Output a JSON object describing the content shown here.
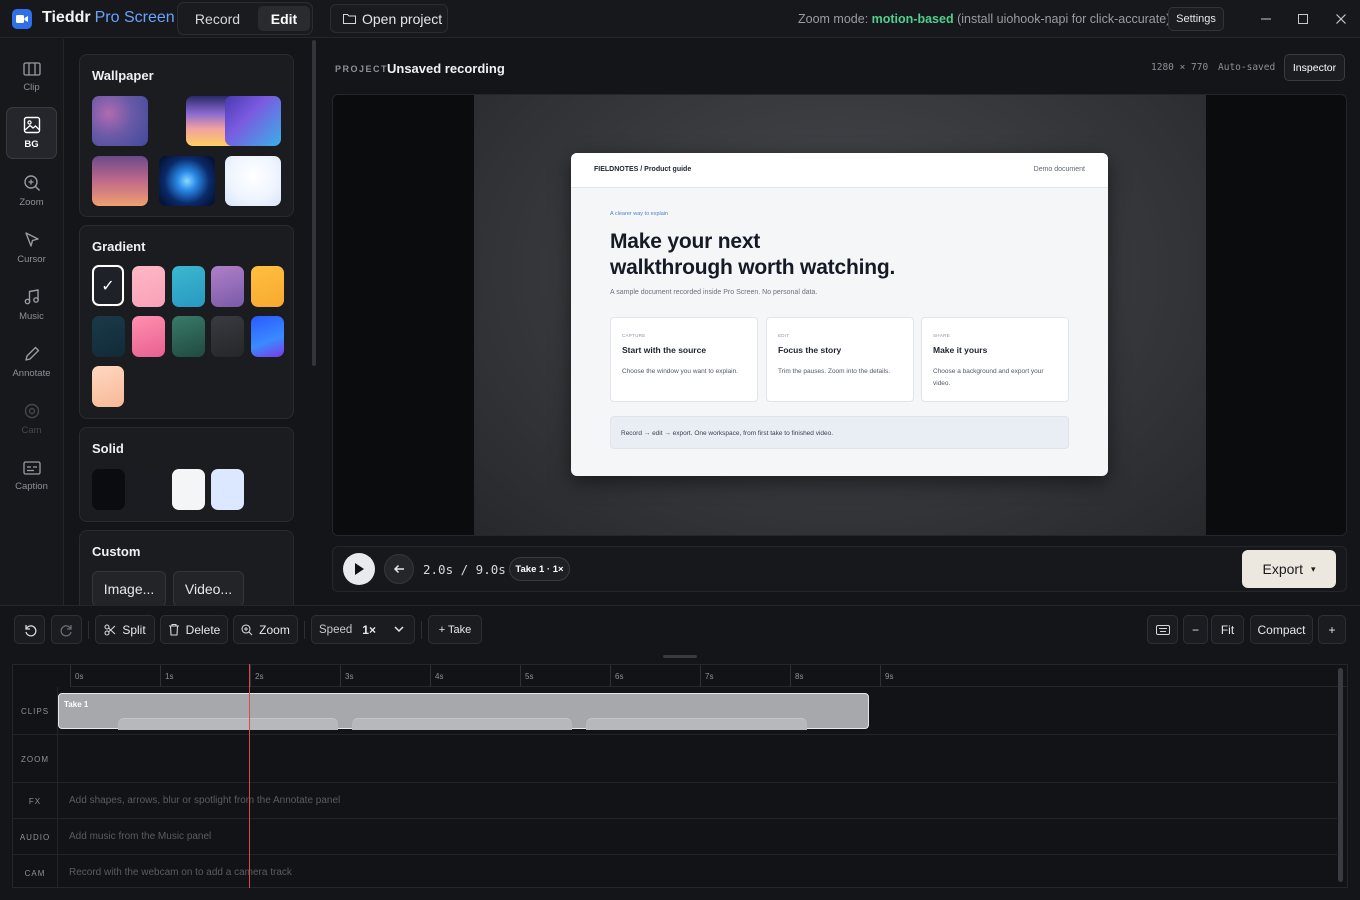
{
  "titlebar": {
    "app_name": "Tieddr",
    "app_name_accent": "Pro Screen",
    "modes": {
      "record": "Record",
      "edit": "Edit"
    },
    "open_project": "Open project",
    "zoom_mode_prefix": "Zoom mode: ",
    "zoom_mode_value": "motion-based",
    "zoom_mode_hint": " (install uiohook-napi for click-accurate)",
    "settings": "Settings"
  },
  "rail": {
    "items": [
      {
        "label": "Clip",
        "icon": "columns-icon"
      },
      {
        "label": "BG",
        "icon": "image-icon",
        "active": true
      },
      {
        "label": "Zoom",
        "icon": "zoom-in-icon"
      },
      {
        "label": "Cursor",
        "icon": "cursor-icon"
      },
      {
        "label": "Music",
        "icon": "music-icon"
      },
      {
        "label": "Annotate",
        "icon": "pencil-icon"
      },
      {
        "label": "Cam",
        "icon": "camera-icon",
        "disabled": true
      },
      {
        "label": "Caption",
        "icon": "caption-icon"
      }
    ]
  },
  "panel": {
    "wallpaper_title": "Wallpaper",
    "gradient_title": "Gradient",
    "solid_title": "Solid",
    "custom_title": "Custom",
    "custom_image": "Image...",
    "custom_video": "Video...",
    "selected_check": "✓"
  },
  "project": {
    "label": "PROJECT",
    "name": "Unsaved recording",
    "dimensions": "1280 × 770",
    "status": "Auto-saved",
    "inspector": "Inspector"
  },
  "document": {
    "brand": "FIELDNOTES / Product guide",
    "demo": "Demo document",
    "kicker": "A clearer way to explain",
    "headline_1": "Make your next",
    "headline_2": "walkthrough worth watching.",
    "subtitle": "A sample document recorded inside Pro Screen. No personal data.",
    "cards": [
      {
        "kicker": "CAPTURE",
        "title": "Start with the source",
        "text": "Choose the window you want to explain."
      },
      {
        "kicker": "EDIT",
        "title": "Focus the story",
        "text": "Trim the pauses. Zoom into the details."
      },
      {
        "kicker": "SHARE",
        "title": "Make it yours",
        "text": "Choose a background and export your video."
      }
    ],
    "footer": "Record → edit → export. One workspace, from first take to finished video."
  },
  "transport": {
    "timecode": "2.0s / 9.0s",
    "take": "Take 1 · 1×",
    "export": "Export",
    "export_caret": "▾"
  },
  "toolbar": {
    "split": "Split",
    "delete": "Delete",
    "zoom": "Zoom",
    "speed_label": "Speed",
    "speed_value": "1×",
    "add_take": "+ Take",
    "zoom_out": "−",
    "fit": "Fit",
    "compact": "Compact",
    "zoom_in": "+"
  },
  "timeline": {
    "ticks": [
      "0s",
      "1s",
      "2s",
      "3s",
      "4s",
      "5s",
      "6s",
      "7s",
      "8s",
      "9s"
    ],
    "lanes": [
      "CLIPS",
      "ZOOM",
      "FX",
      "AUDIO",
      "CAM"
    ],
    "clip_name": "Take 1",
    "playhead_time_s": 2.0,
    "fx_hint": "Add shapes, arrows, blur or spotlight from the Annotate panel",
    "audio_hint": "Add music from the Music panel",
    "cam_hint": "Record with the webcam on to add a camera track"
  },
  "colors": {
    "accent": "#6aa2ff",
    "zoom_mode_highlight": "#4fd08c",
    "playhead": "#e0474c",
    "export_bg": "#ece7df"
  }
}
